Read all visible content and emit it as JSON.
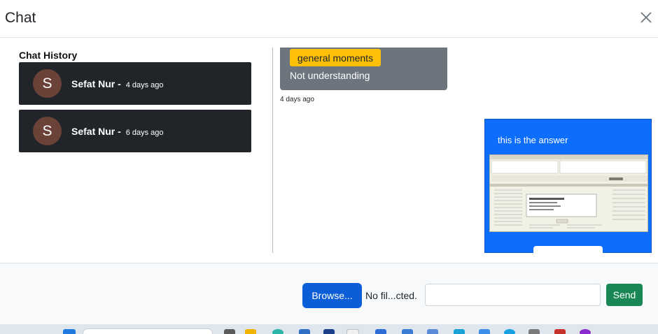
{
  "header": {
    "title": "Chat"
  },
  "history": {
    "label": "Chat History",
    "items": [
      {
        "initial": "S",
        "name": "Sefat Nur -",
        "time": "4 days ago"
      },
      {
        "initial": "S",
        "name": "Sefat Nur -",
        "time": "6 days ago"
      }
    ]
  },
  "messages": {
    "received": {
      "tag": "general moments",
      "text": "Not understanding",
      "time": "4 days ago"
    },
    "sent": {
      "text": "this is the answer"
    }
  },
  "footer": {
    "browse_label": "Browse...",
    "file_status": "No fil...cted.",
    "input_value": "",
    "send_label": "Send"
  },
  "colors": {
    "conversation_bg": "#212529",
    "avatar_bg": "#6b4238",
    "received_bg": "#6c757d",
    "tag_bg": "#ffc107",
    "sent_bg": "#0d6efd",
    "browse_bg": "#0b5ed7",
    "send_bg": "#198754"
  }
}
